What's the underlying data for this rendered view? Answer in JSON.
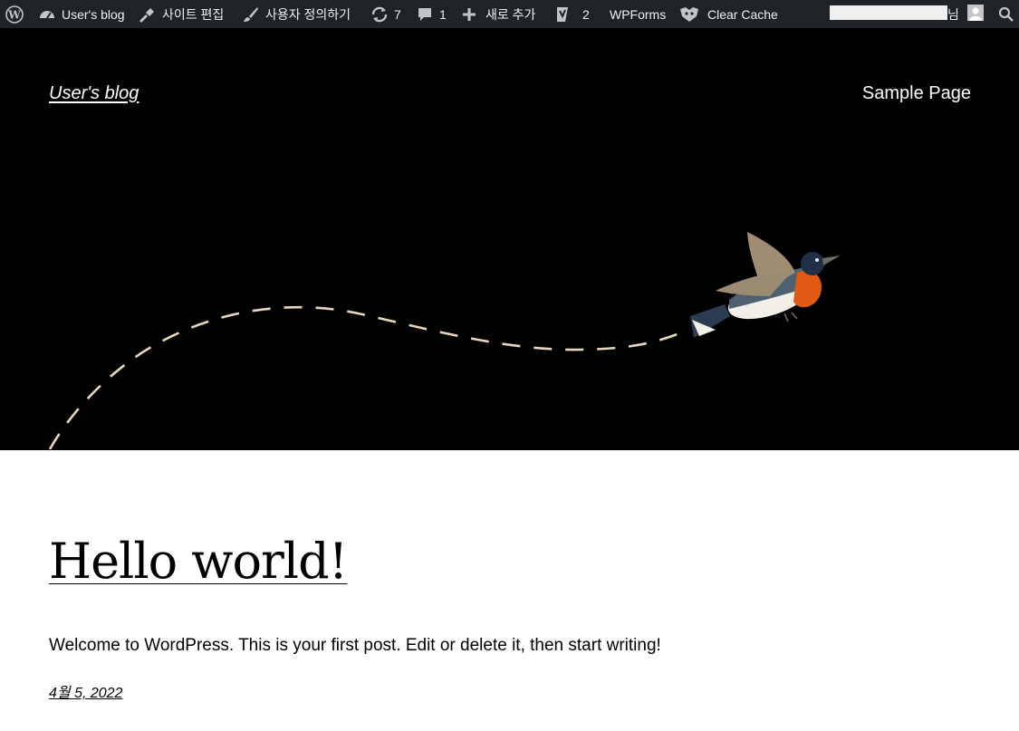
{
  "admin_bar": {
    "site_name": "User's blog",
    "edit_site": "사이트 편집",
    "customize": "사용자 정의하기",
    "updates_count": "7",
    "comments_count": "1",
    "new_content": "새로 추가",
    "yoast_count": "2",
    "wpforms": "WPForms",
    "clear_cache": "Clear Cache",
    "account_suffix": "님",
    "icons": [
      "wordpress-logo-icon",
      "dashboard-icon",
      "brush-icon",
      "paintbrush-icon",
      "refresh-icon",
      "comment-icon",
      "plus-icon",
      "yoast-icon",
      "cache-icon",
      "avatar",
      "search-icon"
    ]
  },
  "header": {
    "site_title": "User's blog",
    "nav": [
      "Sample Page"
    ]
  },
  "post": {
    "title": "Hello world!",
    "excerpt": "Welcome to WordPress. This is your first post. Edit or delete it, then start writing!",
    "date": "4월 5, 2022"
  },
  "colors": {
    "admin_bar_bg": "#1d2327",
    "hero_bg": "#000000",
    "dash_line": "#e8d6be"
  }
}
